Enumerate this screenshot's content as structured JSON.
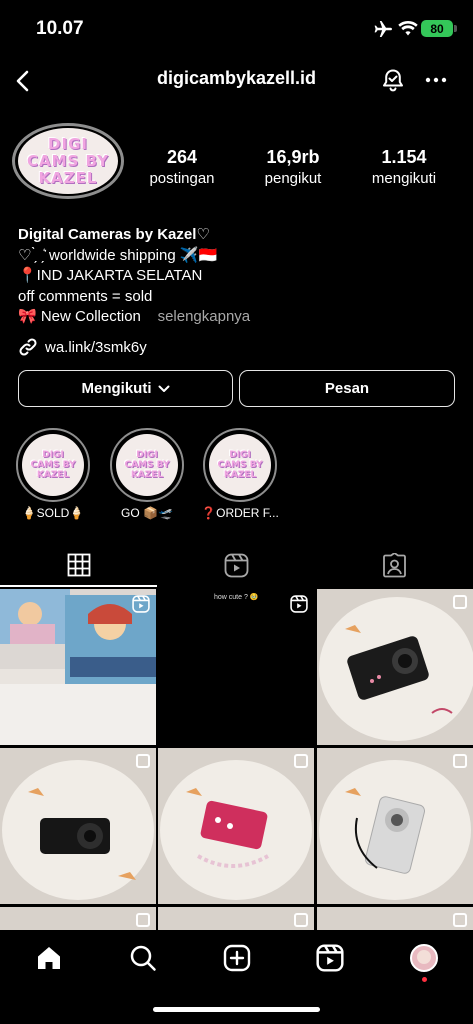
{
  "status_bar": {
    "time": "10.07",
    "battery": "80"
  },
  "header": {
    "username": "digicambykazell.id"
  },
  "avatar": {
    "logo_lines": [
      "DIGI",
      "CAMS BY",
      "KAZEL"
    ]
  },
  "stats": [
    {
      "value": "264",
      "label": "postingan"
    },
    {
      "value": "16,9rb",
      "label": "pengikut"
    },
    {
      "value": "1.154",
      "label": "mengikuti"
    }
  ],
  "bio": {
    "name": "Digital Cameras by Kazel♡",
    "line1": "♡ ̗̀ ˏ͛ worldwide shipping ✈️🇮🇩",
    "line2": "📍IND JAKARTA SELATAN",
    "line3": "off comments = sold",
    "line4": "🎀 New Collection",
    "more": "selengkapnya",
    "link": "wa.link/3smk6y"
  },
  "buttons": {
    "following": "Mengikuti",
    "message": "Pesan"
  },
  "highlights": [
    {
      "label": "🍦SOLD🍦"
    },
    {
      "label": "GO 📦🛫"
    },
    {
      "label": "❓ORDER F..."
    }
  ],
  "highlight_logo": [
    "DIGI",
    "CAMS BY",
    "KAZEL"
  ],
  "posts": {
    "caption_reel2": "how cute ? 🥹"
  },
  "colors": {
    "battery": "#34c759",
    "avatar_bg": "#f3ecea",
    "logo": "#f0a5e0",
    "notif_dot": "#ff3040"
  }
}
